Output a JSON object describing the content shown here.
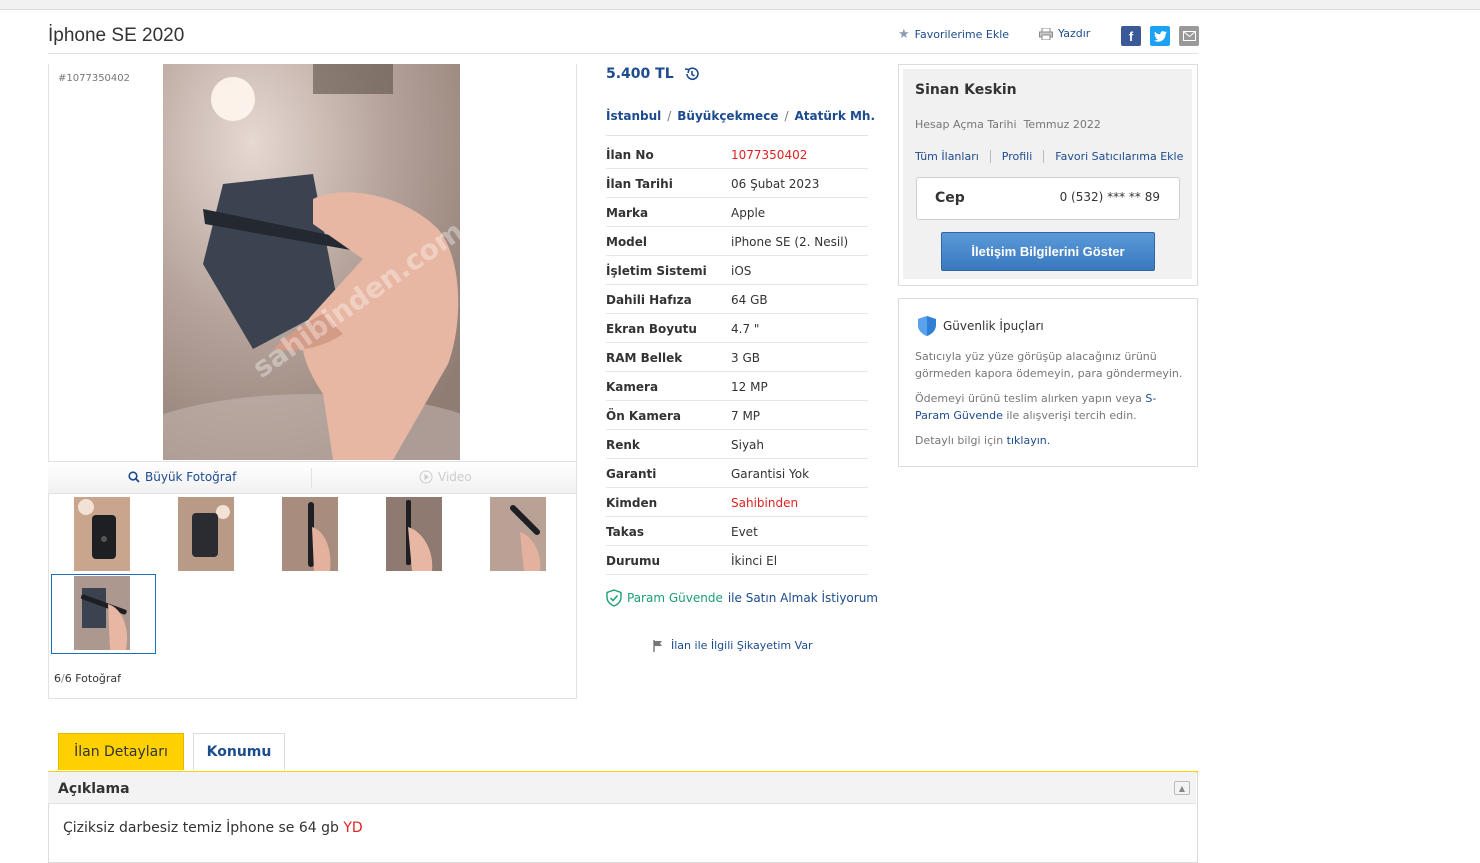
{
  "listing": {
    "title": "İphone SE 2020",
    "ad_no_small": "#1077350402",
    "price": "5.400 TL",
    "location": [
      "İstanbul",
      "Büyükçekmece",
      "Atatürk Mh."
    ],
    "location_sep": "/"
  },
  "toolbar": {
    "favorite": "Favorilerime Ekle",
    "print": "Yazdır"
  },
  "gallery": {
    "big_photo": "Büyük Fotoğraf",
    "video": "Video",
    "photo_count_current": "6",
    "photo_count_sep": "/",
    "photo_count_total": "6 Fotoğraf"
  },
  "details": [
    {
      "k": "İlan No",
      "v": "1077350402",
      "red": true
    },
    {
      "k": "İlan Tarihi",
      "v": "06 Şubat 2023"
    },
    {
      "k": "Marka",
      "v": "Apple"
    },
    {
      "k": "Model",
      "v": "iPhone SE (2. Nesil)"
    },
    {
      "k": "İşletim Sistemi",
      "v": "iOS"
    },
    {
      "k": "Dahili Hafıza",
      "v": "64 GB"
    },
    {
      "k": "Ekran Boyutu",
      "v": "4.7 \""
    },
    {
      "k": "RAM Bellek",
      "v": "3 GB"
    },
    {
      "k": "Kamera",
      "v": "12 MP"
    },
    {
      "k": "Ön Kamera",
      "v": "7 MP"
    },
    {
      "k": "Renk",
      "v": "Siyah"
    },
    {
      "k": "Garanti",
      "v": "Garantisi Yok"
    },
    {
      "k": "Kimden",
      "v": "Sahibinden",
      "red": true
    },
    {
      "k": "Takas",
      "v": "Evet"
    },
    {
      "k": "Durumu",
      "v": "İkinci El"
    }
  ],
  "param": {
    "brand": "Param Güvende",
    "text": "ile Satın Almak İstiyorum"
  },
  "complaint": "İlan ile İlgili Şikayetim Var",
  "seller": {
    "name": "Sinan Keskin",
    "since_label": "Hesap Açma Tarihi",
    "since_value": "Temmuz 2022",
    "links": [
      "Tüm İlanları",
      "Profili",
      "Favori Satıcılarıma Ekle"
    ],
    "phone_label": "Cep",
    "phone_number": "0 (532) *** ** 89",
    "contact_button": "İletişim Bilgilerini Göster"
  },
  "tips": {
    "title": "Güvenlik İpuçları",
    "p1": "Satıcıyla yüz yüze görüşüp alacağınız ürünü görmeden kapora ödemeyin, para göndermeyin.",
    "p2_a": "Ödemeyi ürünü teslim alırken yapın veya",
    "p2_link": "S-Param Güvende",
    "p2_b": "ile alışverişi tercih edin.",
    "p3_a": "Detaylı bilgi için",
    "p3_link": "tıklayın."
  },
  "tabs": {
    "details": "İlan Detayları",
    "location": "Konumu"
  },
  "description": {
    "title": "Açıklama",
    "text": "Çiziksiz darbesiz temiz İphone se 64 gb",
    "suffix": "YD"
  },
  "colors": {
    "link_blue": "#1c4b8e",
    "red": "#e02222",
    "tab_yellow": "#ffd100",
    "param_green": "#1a9e75"
  }
}
